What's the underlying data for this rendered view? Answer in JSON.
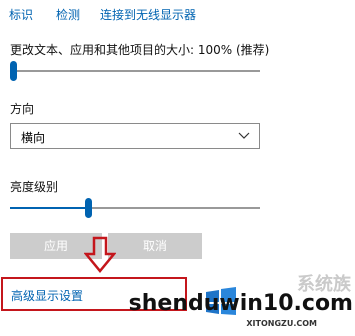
{
  "top_nav": {
    "items": [
      "标识",
      "检测",
      "连接到无线显示器"
    ]
  },
  "scale": {
    "label": "更改文本、应用和其他项目的大小: 100% (推荐)",
    "slider_value": 0
  },
  "orientation": {
    "label": "方向",
    "selected": "横向"
  },
  "brightness": {
    "label": "亮度级别",
    "slider_value": 0.31
  },
  "buttons": {
    "apply": "应用",
    "cancel": "取消"
  },
  "advanced_link": "高级显示设置",
  "watermark": {
    "brand": "shenduwin10.com",
    "sub": "XITONGZU.COM",
    "chinese": "系统族"
  },
  "colors": {
    "link": "#0063b1",
    "annotation_red": "#c4161c",
    "button_disabled": "#cccccc"
  }
}
